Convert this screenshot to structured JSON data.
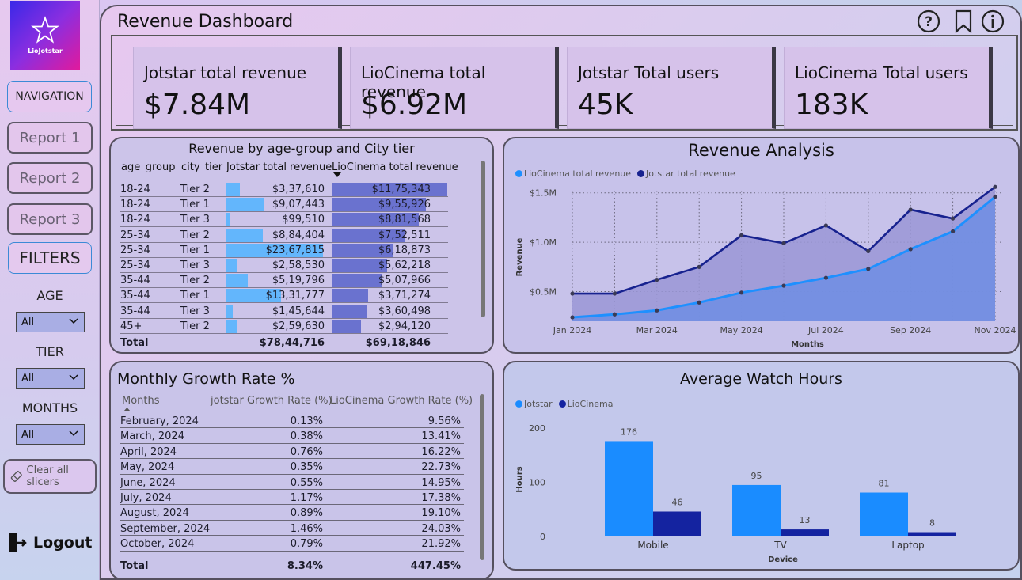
{
  "sidebar": {
    "logo_text": "LioJotstar",
    "navigation": "NAVIGATION",
    "reports": [
      "Report 1",
      "Report 2",
      "Report 3"
    ],
    "filters": "FILTERS",
    "age_label": "AGE",
    "age_value": "All",
    "tier_label": "TIER",
    "tier_value": "All",
    "months_label": "MONTHS",
    "months_value": "All",
    "clear": "Clear all slicers",
    "logout": "Logout"
  },
  "header": {
    "title": "Revenue Dashboard",
    "icons": [
      "help-icon",
      "bookmark-icon",
      "info-icon"
    ]
  },
  "kpis": [
    {
      "label": "Jotstar total revenue",
      "value": "$7.84M"
    },
    {
      "label": "LioCinema total revenue",
      "value": "$6.92M"
    },
    {
      "label": "Jotstar Total users",
      "value": "45K"
    },
    {
      "label": "LioCinema Total users",
      "value": "183K"
    }
  ],
  "revenue_table": {
    "title": "Revenue by age-group and City tier",
    "columns": [
      "age_group",
      "city_tier",
      "Jotstar total revenue",
      "LioCinema total revenue"
    ],
    "rows": [
      {
        "age": "18-24",
        "tier": "Tier 2",
        "jot": "$3,37,610",
        "lio": "$11,75,343",
        "jot_v": 337610,
        "lio_v": 1175343
      },
      {
        "age": "18-24",
        "tier": "Tier 1",
        "jot": "$9,07,443",
        "lio": "$9,55,926",
        "jot_v": 907443,
        "lio_v": 955926
      },
      {
        "age": "18-24",
        "tier": "Tier 3",
        "jot": "$99,510",
        "lio": "$8,81,568",
        "jot_v": 99510,
        "lio_v": 881568
      },
      {
        "age": "25-34",
        "tier": "Tier 2",
        "jot": "$8,84,404",
        "lio": "$7,52,511",
        "jot_v": 884404,
        "lio_v": 752511
      },
      {
        "age": "25-34",
        "tier": "Tier 1",
        "jot": "$23,67,815",
        "lio": "$6,18,873",
        "jot_v": 2367815,
        "lio_v": 618873
      },
      {
        "age": "25-34",
        "tier": "Tier 3",
        "jot": "$2,58,530",
        "lio": "$5,62,218",
        "jot_v": 258530,
        "lio_v": 562218
      },
      {
        "age": "35-44",
        "tier": "Tier 2",
        "jot": "$5,19,796",
        "lio": "$5,07,966",
        "jot_v": 519796,
        "lio_v": 507966
      },
      {
        "age": "35-44",
        "tier": "Tier 1",
        "jot": "$13,31,777",
        "lio": "$3,71,274",
        "jot_v": 1331777,
        "lio_v": 371274
      },
      {
        "age": "35-44",
        "tier": "Tier 3",
        "jot": "$1,45,644",
        "lio": "$3,60,498",
        "jot_v": 145644,
        "lio_v": 360498
      },
      {
        "age": "45+",
        "tier": "Tier 2",
        "jot": "$2,59,630",
        "lio": "$2,94,120",
        "jot_v": 259630,
        "lio_v": 294120
      }
    ],
    "total_label": "Total",
    "total_jot": "$78,44,716",
    "total_lio": "$69,18,846"
  },
  "growth_table": {
    "title": "Monthly Growth Rate %",
    "columns": [
      "Months",
      "jotstar Growth Rate (%)",
      "LioCinema Growth Rate (%)"
    ],
    "rows": [
      {
        "month": "February, 2024",
        "jot": "0.13%",
        "lio": "9.56%"
      },
      {
        "month": "March, 2024",
        "jot": "0.38%",
        "lio": "13.41%"
      },
      {
        "month": "April, 2024",
        "jot": "0.76%",
        "lio": "16.22%"
      },
      {
        "month": "May, 2024",
        "jot": "0.35%",
        "lio": "22.73%"
      },
      {
        "month": "June, 2024",
        "jot": "0.55%",
        "lio": "14.95%"
      },
      {
        "month": "July, 2024",
        "jot": "1.17%",
        "lio": "17.38%"
      },
      {
        "month": "August, 2024",
        "jot": "0.89%",
        "lio": "19.10%"
      },
      {
        "month": "September, 2024",
        "jot": "1.46%",
        "lio": "24.03%"
      },
      {
        "month": "October, 2024",
        "jot": "0.79%",
        "lio": "21.92%"
      }
    ],
    "total_label": "Total",
    "total_jot": "8.34%",
    "total_lio": "447.45%"
  },
  "colors": {
    "lio_blue": "#1e90ff",
    "jot_navy": "#17228f",
    "lio_bar": "#1a8cff",
    "jot_bar": "#1423a0"
  },
  "chart_data": [
    {
      "type": "area",
      "title": "Revenue Analysis",
      "xlabel": "Months",
      "ylabel": "Revenue",
      "x": [
        "Jan 2024",
        "Feb 2024",
        "Mar 2024",
        "Apr 2024",
        "May 2024",
        "Jun 2024",
        "Jul 2024",
        "Aug 2024",
        "Sep 2024",
        "Oct 2024",
        "Nov 2024"
      ],
      "x_ticks": [
        "Jan 2024",
        "Mar 2024",
        "May 2024",
        "Jul 2024",
        "Sep 2024",
        "Nov 2024"
      ],
      "y_ticks": [
        "$0.5M",
        "$1.0M",
        "$1.5M"
      ],
      "ylim": [
        0.2,
        1.65
      ],
      "grid": true,
      "legend": "top-left",
      "series": [
        {
          "name": "LioCinema total revenue",
          "values": [
            0.24,
            0.27,
            0.31,
            0.39,
            0.49,
            0.56,
            0.64,
            0.73,
            0.93,
            1.11,
            1.46
          ]
        },
        {
          "name": "Jotstar total revenue",
          "values": [
            0.48,
            0.48,
            0.62,
            0.75,
            1.07,
            0.99,
            1.17,
            0.91,
            1.33,
            1.24,
            1.56
          ]
        }
      ]
    },
    {
      "type": "bar",
      "title": "Average Watch Hours",
      "xlabel": "Device",
      "ylabel": "Hours",
      "categories": [
        "Mobile",
        "TV",
        "Laptop"
      ],
      "y_ticks": [
        "0",
        "100",
        "200"
      ],
      "ylim": [
        0,
        200
      ],
      "legend": "top-left",
      "series": [
        {
          "name": "Jotstar",
          "values": [
            176,
            95,
            81
          ]
        },
        {
          "name": "LioCinema",
          "values": [
            46,
            13,
            8
          ]
        }
      ]
    }
  ]
}
